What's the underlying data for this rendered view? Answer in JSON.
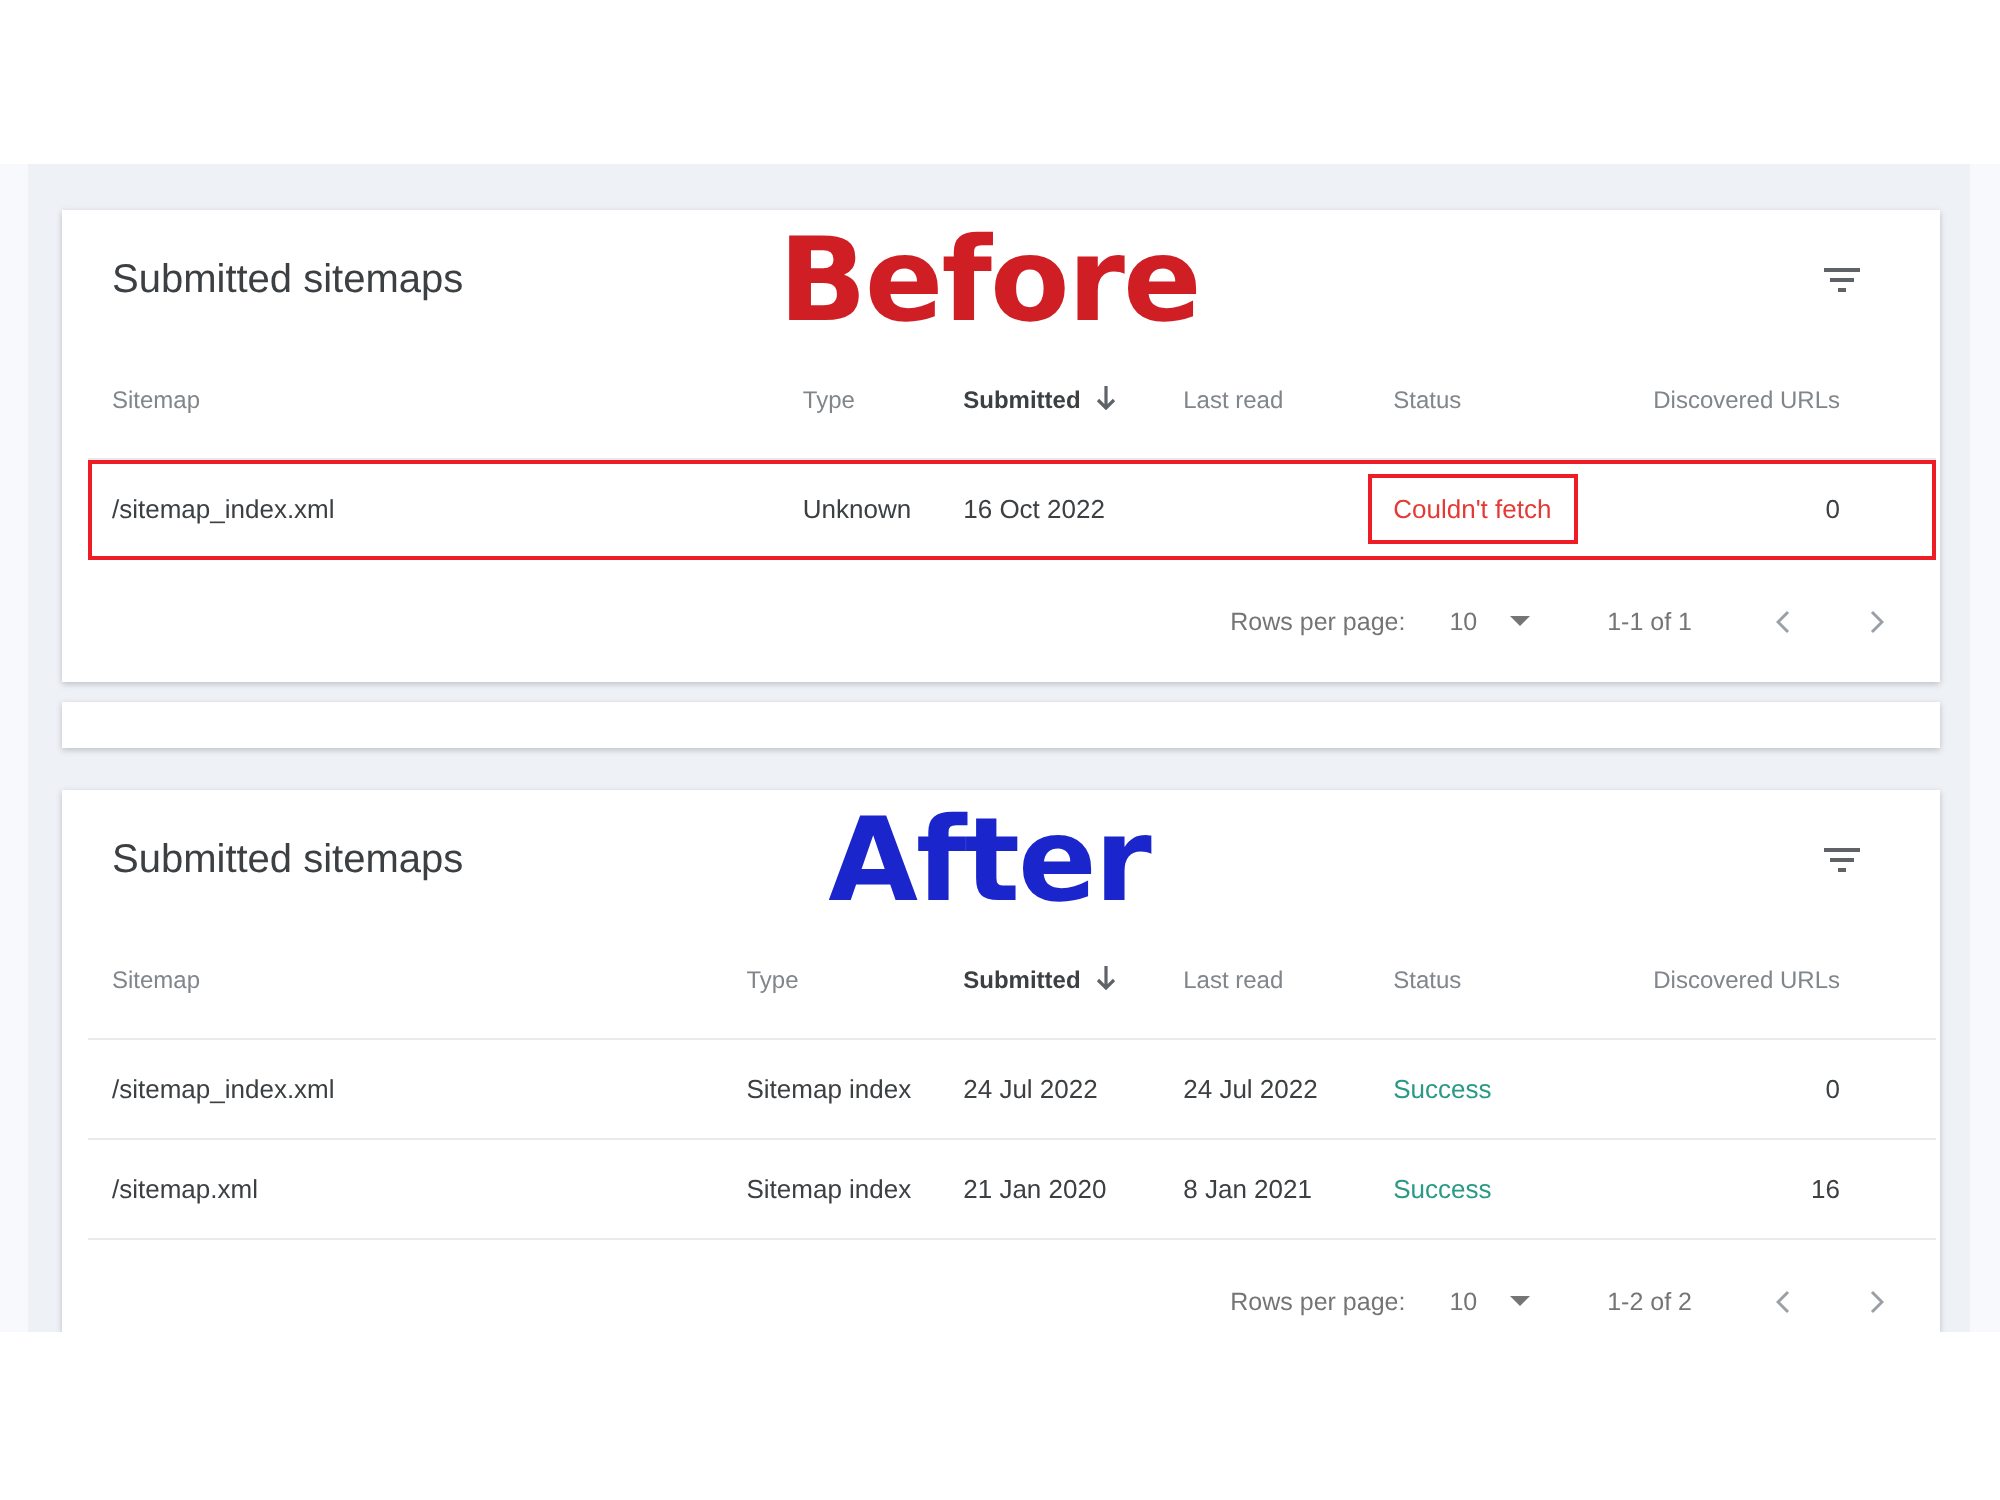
{
  "panels": [
    {
      "caption": "Before",
      "color": "#cf1f25",
      "title": "Submitted sitemaps",
      "columns": [
        {
          "label": "Sitemap",
          "sorted": false
        },
        {
          "label": "Type",
          "sorted": false
        },
        {
          "label": "Submitted",
          "sorted": true
        },
        {
          "label": "Last read",
          "sorted": false
        },
        {
          "label": "Status",
          "sorted": false
        },
        {
          "label": "Discovered URLs",
          "sorted": false
        }
      ],
      "rows": [
        {
          "outlined": true,
          "sitemap": "/sitemap_index.xml",
          "type": "Unknown",
          "submitted": "16 Oct 2022",
          "status": {
            "text": "Couldn't fetch",
            "kind": "error",
            "outlined": true
          },
          "discovered_urls": "0"
        }
      ],
      "pagination": {
        "rows_per_page_label": "Rows per page:",
        "rows_per_page": "10",
        "range": "1-1 of 1"
      }
    },
    {
      "caption": "After",
      "color": "#1b25cc",
      "title": "Submitted sitemaps",
      "columns": [
        {
          "label": "Sitemap",
          "sorted": false
        },
        {
          "label": "Type",
          "sorted": false
        },
        {
          "label": "Submitted",
          "sorted": true
        },
        {
          "label": "Last read",
          "sorted": false
        },
        {
          "label": "Status",
          "sorted": false
        },
        {
          "label": "Discovered URLs",
          "sorted": false
        }
      ],
      "rows": [
        {
          "outlined": false,
          "sitemap": "/sitemap_index.xml",
          "type": "Sitemap index",
          "submitted": "24 Jul 2022",
          "last_read": "24 Jul 2022",
          "status": {
            "text": "Success",
            "kind": "success",
            "outlined": false
          },
          "discovered_urls": "0"
        },
        {
          "outlined": false,
          "sitemap": "/sitemap.xml",
          "type": "Sitemap index",
          "submitted": "21 Jan 2020",
          "last_read": "8 Jan 2021",
          "status": {
            "text": "Success",
            "kind": "success",
            "outlined": false
          },
          "discovered_urls": "16"
        }
      ],
      "pagination": {
        "rows_per_page_label": "Rows per page:",
        "rows_per_page": "10",
        "range": "1-2 of 2"
      }
    }
  ]
}
